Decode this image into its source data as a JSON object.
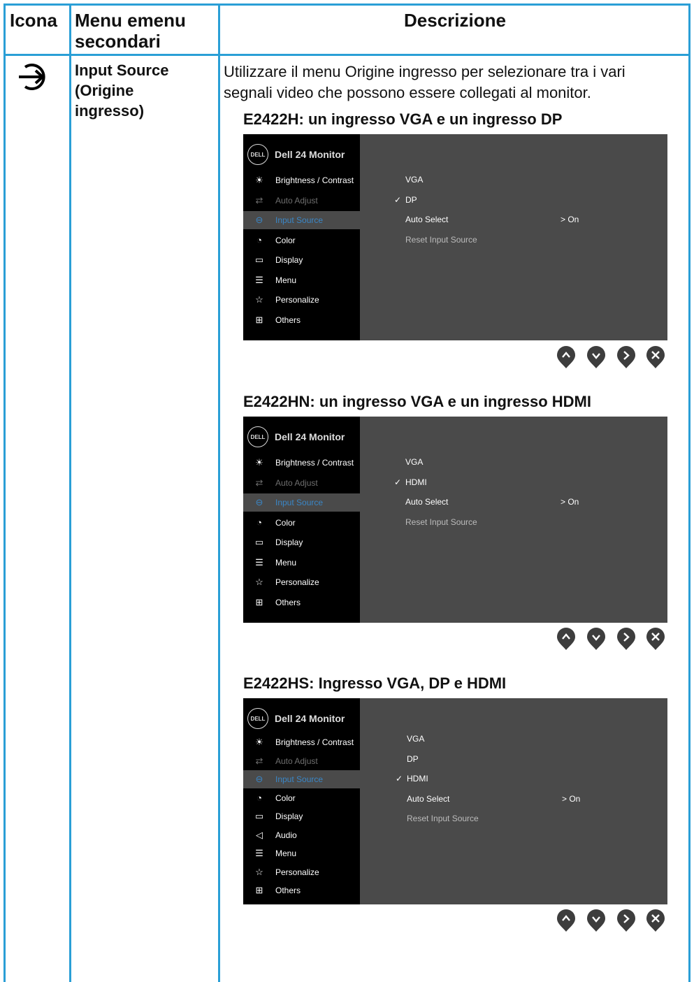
{
  "header": {
    "col1": "Icona",
    "col2_line1": "Menu emenu",
    "col2_line2": "secondari",
    "col3": "Descrizione"
  },
  "row": {
    "menu_line1": "Input Source",
    "menu_line2": "(Origine",
    "menu_line3": "ingresso)",
    "desc_line1": "Utilizzare il menu Origine ingresso per selezionare tra i vari",
    "desc_line2": "segnali video che possono essere collegati al monitor."
  },
  "osd_common": {
    "brand": "DELL",
    "title": "Dell 24 Monitor",
    "auto_select": "Auto Select",
    "auto_value": "> On",
    "reset": "Reset Input Source",
    "check": "✓"
  },
  "sections": [
    {
      "title": "E2422H: un ingresso VGA e un ingresso DP",
      "menu": [
        "Brightness / Contrast",
        "Auto Adjust",
        "Input Source",
        "Color",
        "Display",
        "Menu",
        "Personalize",
        "Others"
      ],
      "inputs": [
        "VGA",
        "DP"
      ]
    },
    {
      "title": "E2422HN: un ingresso VGA e un ingresso HDMI",
      "menu": [
        "Brightness / Contrast",
        "Auto Adjust",
        "Input Source",
        "Color",
        "Display",
        "Menu",
        "Personalize",
        "Others"
      ],
      "inputs": [
        "VGA",
        "HDMI"
      ]
    },
    {
      "title": "E2422HS: Ingresso VGA, DP e HDMI",
      "menu": [
        "Brightness / Contrast",
        "Auto Adjust",
        "Input Source",
        "Color",
        "Display",
        "Audio",
        "Menu",
        "Personalize",
        "Others"
      ],
      "inputs": [
        "VGA",
        "DP",
        "HDMI"
      ]
    }
  ],
  "colors": {
    "border": "#2a9fd6",
    "osd_bg": "#4a4a4a",
    "highlight": "#3a86c6"
  }
}
